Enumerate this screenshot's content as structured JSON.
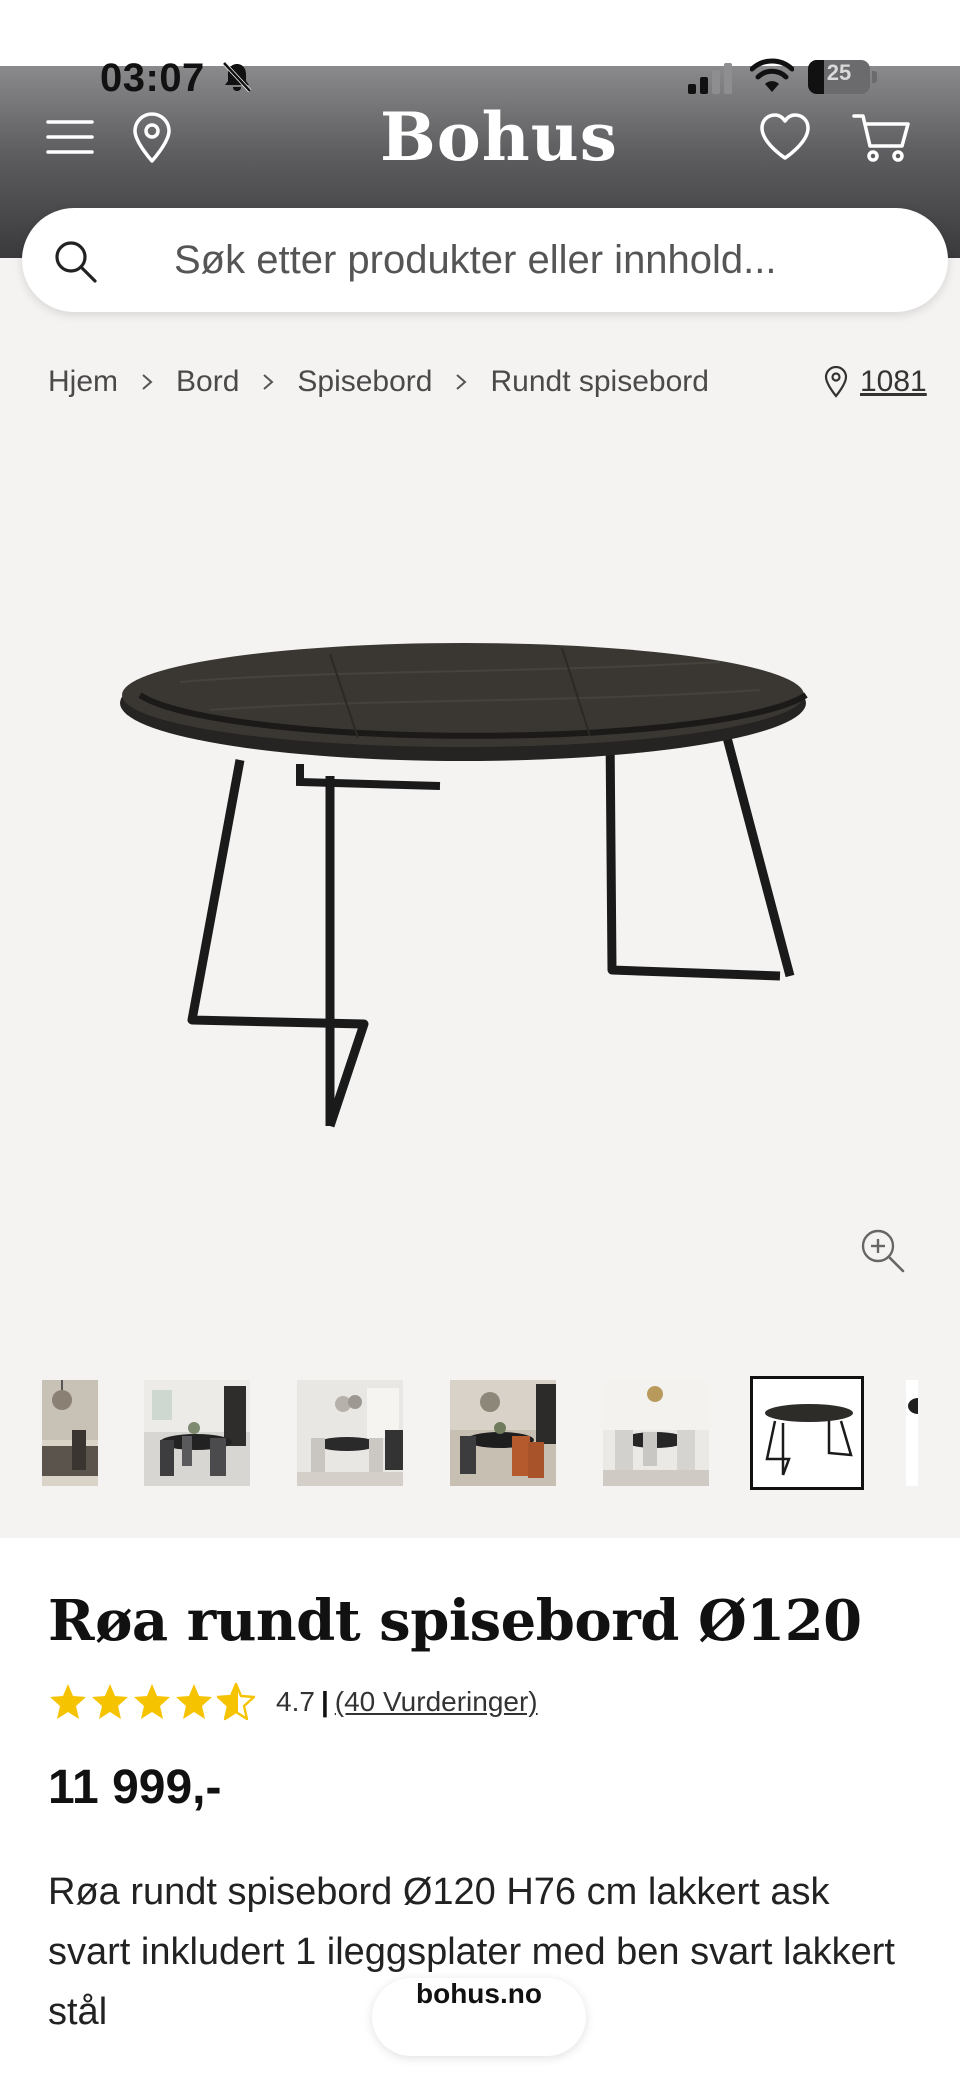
{
  "status_bar": {
    "time": "03:07",
    "battery_level": "25",
    "battery_fraction": 0.25
  },
  "header": {
    "logo": "Bohus",
    "icons": [
      "menu-icon",
      "location-icon",
      "heart-icon",
      "cart-icon"
    ]
  },
  "search": {
    "placeholder": "Søk etter produkter eller innhold..."
  },
  "breadcrumb": {
    "items": [
      "Hjem",
      "Bord",
      "Spisebord",
      "Rundt spisebord"
    ]
  },
  "store": {
    "code": "1081"
  },
  "thumbnails": {
    "count": 7,
    "active_index": 5
  },
  "product": {
    "title": "Røa rundt spisebord Ø120",
    "rating_value": "4.7",
    "rating_separator": "|",
    "rating_count_label": "(40 Vurderinger)",
    "rating_stars": 4.7,
    "price": "11 999,-",
    "description": "Røa rundt spisebord Ø120 H76 cm lakkert ask svart inkludert 1 ileggsplater med ben svart lakkert stål"
  },
  "browser": {
    "url": "bohus.no"
  },
  "colors": {
    "header_dark": "#3a3a3d",
    "star_yellow": "#f6c300",
    "page_background": "#f5f3f1"
  }
}
